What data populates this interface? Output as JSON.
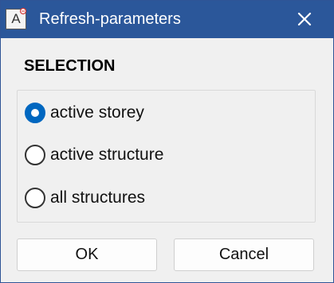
{
  "window": {
    "title": "Refresh-parameters",
    "icon": "text-field-icon",
    "icon_glyph": "A",
    "close_glyph": "close-icon"
  },
  "selection": {
    "heading": "SELECTION",
    "options": [
      {
        "label": "active storey",
        "checked": true
      },
      {
        "label": "active structure",
        "checked": false
      },
      {
        "label": "all structures",
        "checked": false
      }
    ]
  },
  "buttons": {
    "ok_label": "OK",
    "cancel_label": "Cancel"
  },
  "colors": {
    "titlebar": "#2b579a",
    "accent": "#0067c0",
    "background": "#f0f0f0"
  }
}
